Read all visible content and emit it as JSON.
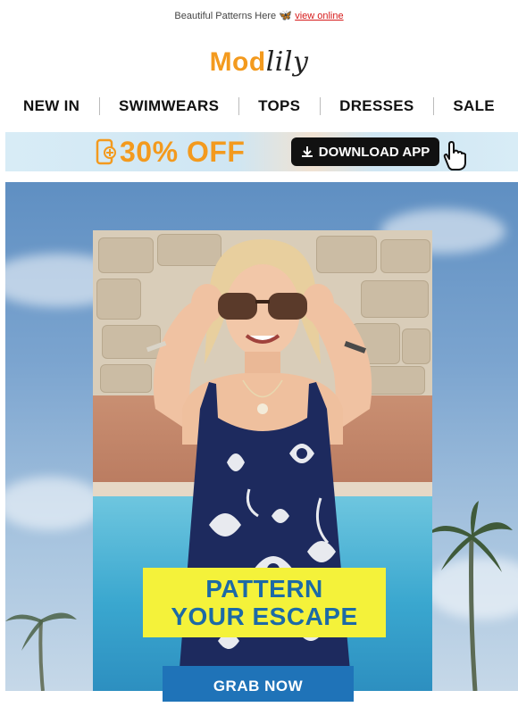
{
  "preheader": {
    "text": "Beautiful Patterns Here",
    "link": "view online",
    "icon": "butterfly-icon"
  },
  "logo": {
    "part1": "Mod",
    "part2": "lily"
  },
  "nav": {
    "items": [
      "NEW IN",
      "SWIMWEARS",
      "TOPS",
      "DRESSES",
      "SALE"
    ]
  },
  "app_banner": {
    "offer": "30% OFF",
    "button": "DOWNLOAD APP",
    "icons": [
      "phone-icon",
      "download-icon",
      "pointer-hand-icon"
    ]
  },
  "hero": {
    "headline_line1": "PATTERN",
    "headline_line2": "YOUR ESCAPE",
    "button": "GRAB NOW"
  },
  "colors": {
    "brand_orange": "#f39a1e",
    "headline_bg": "#f4f23a",
    "headline_text": "#1c6aa6",
    "cta_blue": "#1f73b8",
    "link_red": "#d61a1a"
  }
}
